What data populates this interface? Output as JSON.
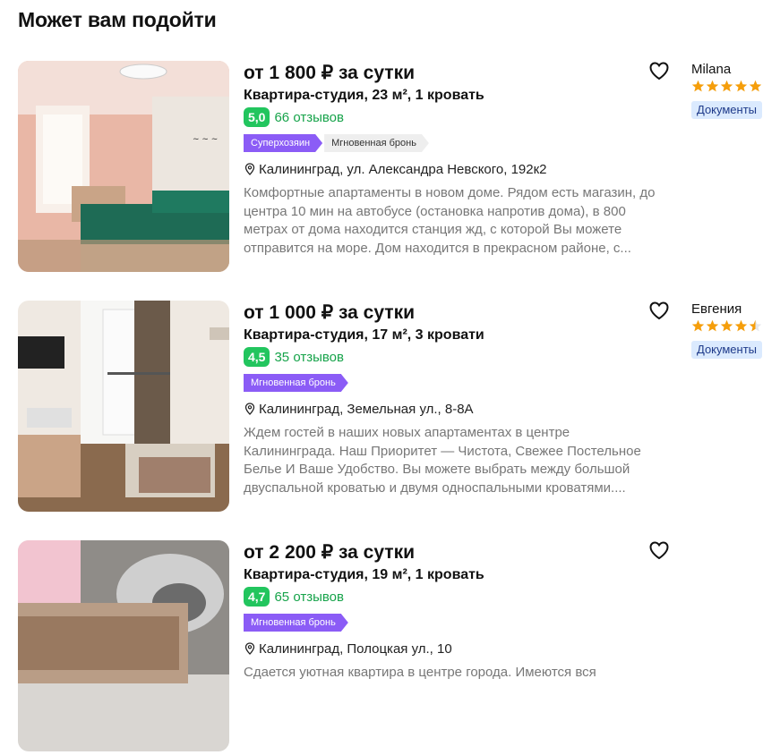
{
  "section": {
    "title": "Может вам подойти"
  },
  "listings": [
    {
      "price": "от 1 800 ₽ за сутки",
      "subtitle": "Квартира-студия, 23 м², 1 кровать",
      "score": "5,0",
      "reviews": "66 отзывов",
      "tags": [
        "Суперхозяин",
        "Мгновенная бронь"
      ],
      "address": "Калининград, ул. Александра Невского, 192к2",
      "description": "Комфортные апартаменты в новом доме. Рядом есть магазин, до центра 10 мин на автобусе (остановка напротив дома), в 800 метрах от дома находится станция жд, с которой Вы можете отправится на море. Дом находится в прекрасном районе, с...",
      "host": {
        "name": "Milana",
        "stars": 5,
        "badge": "Документы"
      }
    },
    {
      "price": "от 1 000 ₽ за сутки",
      "subtitle": "Квартира-студия, 17 м², 3 кровати",
      "score": "4,5",
      "reviews": "35 отзывов",
      "tags": [
        "Мгновенная бронь"
      ],
      "address": "Калининград, Земельная ул., 8-8А",
      "description": "Ждем гостей в наших новых апартаментах в центре Калининграда. Наш Приоритет — Чистота, Свежее Постельное Белье И Ваше Удобство. Вы можете выбрать между большой двуспальной кроватью и двумя односпальными кроватями....",
      "host": {
        "name": "Евгения",
        "stars": 4.5,
        "badge": "Документы"
      }
    },
    {
      "price": "от 2 200 ₽ за сутки",
      "subtitle": "Квартира-студия, 19 м², 1 кровать",
      "score": "4,7",
      "reviews": "65 отзывов",
      "tags": [
        "Мгновенная бронь"
      ],
      "address": "Калининград, Полоцкая ул., 10",
      "description": "Сдается уютная квартира в центре города. Имеются вся",
      "host": null
    }
  ],
  "colors": {
    "score_bg": "#22c55e",
    "reviews": "#16a34a",
    "tag_purple": "#8b5cf6",
    "star": "#f59e0b",
    "docs_bg": "#dbeafe"
  },
  "icons": {
    "favorite": "heart-outline-icon",
    "location": "map-pin-icon",
    "rating": "star-icon"
  }
}
